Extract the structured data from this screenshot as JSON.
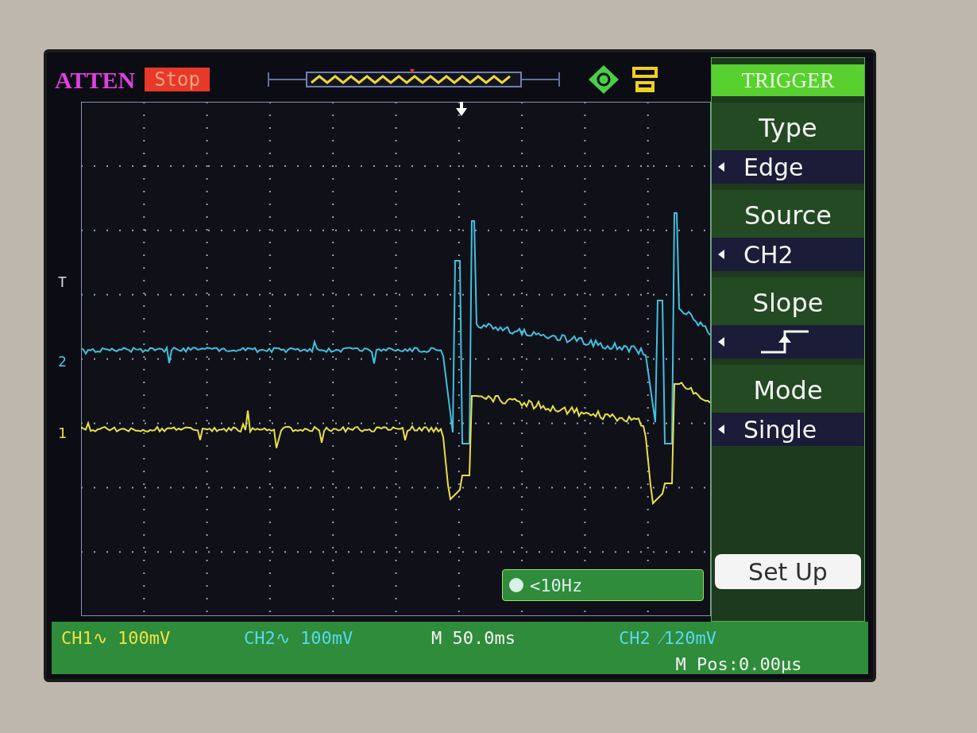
{
  "header": {
    "label": "ATTEN",
    "state": "Stop"
  },
  "markers": [
    {
      "label": "T",
      "color": "#d8d8e8"
    },
    {
      "label": "2",
      "color": "#48c8e8"
    },
    {
      "label": "1",
      "color": "#e8e048"
    }
  ],
  "frequency": "<10Hz",
  "menu": {
    "title": "TRIGGER",
    "items": [
      {
        "label": "Type",
        "kind": "text",
        "value": "Edge"
      },
      {
        "label": "Source",
        "kind": "text",
        "value": "CH2"
      },
      {
        "label": "Slope",
        "kind": "rising"
      },
      {
        "label": "Mode",
        "kind": "text",
        "value": "Single"
      }
    ],
    "button": {
      "label": "Set Up",
      "selected": true
    }
  },
  "status": [
    {
      "text": "CH1∿ 100mV",
      "color": "#f0e048"
    },
    {
      "text": "CH2∿ 100mV",
      "color": "#58d8f0"
    },
    {
      "text": "M 50.0ms",
      "color": "#f4f4f4"
    },
    {
      "text": "CH2 ⁄120mV",
      "color": "#58d8f0"
    },
    {
      "text": "M Pos:0.00μs",
      "color": "#f4f4f4"
    }
  ]
}
